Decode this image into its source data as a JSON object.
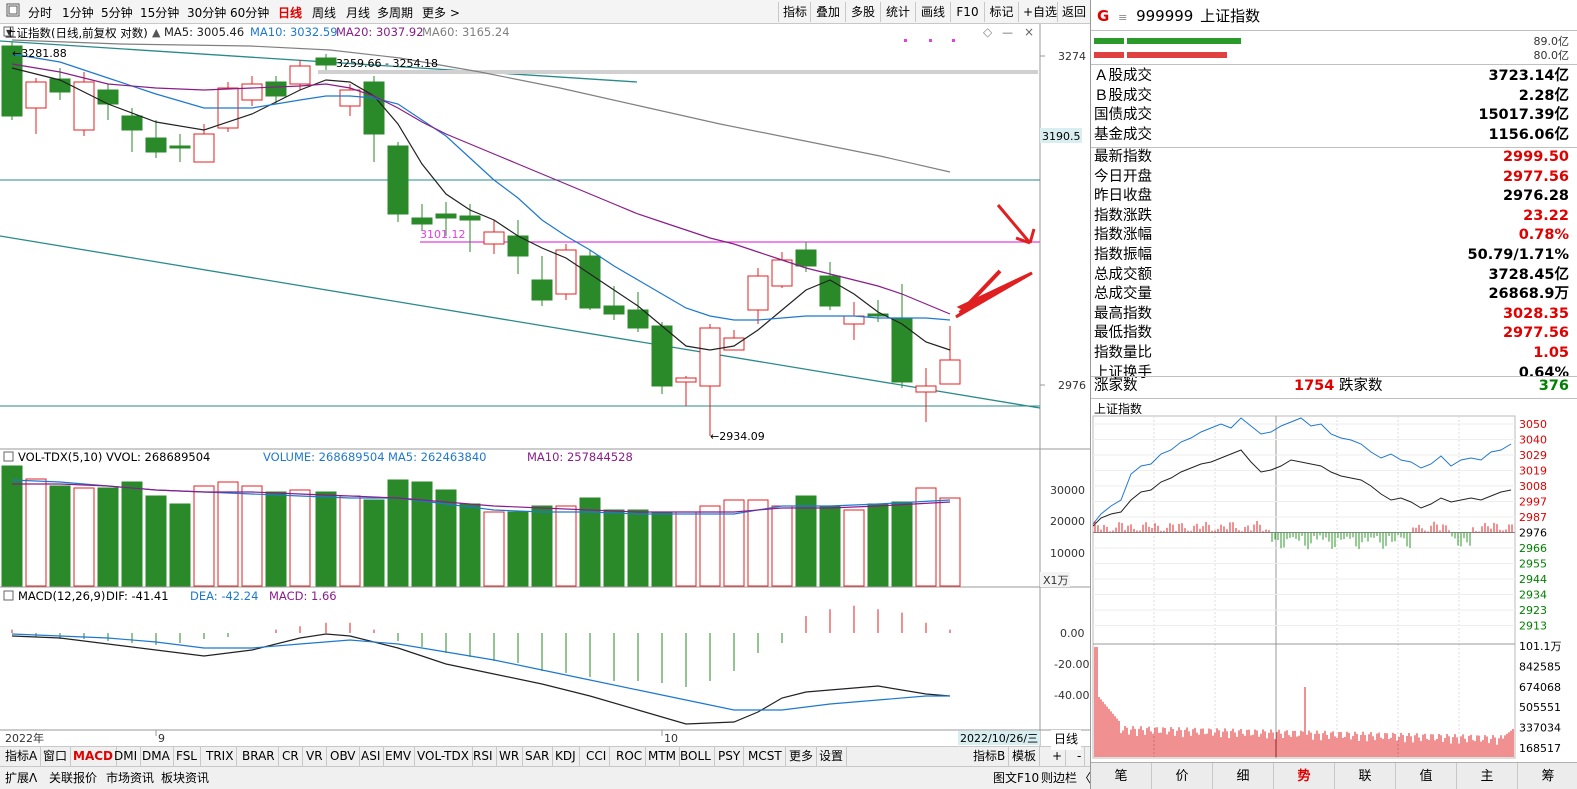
{
  "toolbar": {
    "periods": [
      "分时",
      "1分钟",
      "5分钟",
      "15分钟",
      "30分钟",
      "60分钟",
      "日线",
      "周线",
      "月线",
      "多周期",
      "更多"
    ],
    "active_period": "日线",
    "right_buttons": [
      "指标",
      "叠加",
      "多股",
      "统计",
      "画线",
      "F10",
      "标记",
      "+自选",
      "返回"
    ]
  },
  "main_chart": {
    "title": "上证指数(日线,前复权 对数)",
    "ma_labels": [
      {
        "text": "MA5: 3005.46",
        "color": "#222222"
      },
      {
        "text": "MA10: 3032.59",
        "color": "#1e78d0"
      },
      {
        "text": "MA20: 3037.92",
        "color": "#8a1c8a"
      },
      {
        "text": "MA60: 3165.24",
        "color": "#808080"
      }
    ],
    "price_axis": [
      "3274",
      "3190.5",
      "2976"
    ],
    "highlight_price": "3190.5",
    "annotations": {
      "high": "3281.88",
      "range": "3259.66 - 3254.18",
      "level": "3101.12",
      "low": "2934.09"
    },
    "date_labels": [
      "2022年",
      "9",
      "10"
    ],
    "current_date": "2022/10/26/三"
  },
  "volume_chart": {
    "labels": [
      {
        "text": "VOL-TDX(5,10)",
        "color": "#000000"
      },
      {
        "text": "VVOL: 268689504",
        "color": "#000000"
      },
      {
        "text": "VOLUME: 268689504",
        "color": "#1e78d0"
      },
      {
        "text": "MA5: 262463840",
        "color": "#1e78d0"
      },
      {
        "text": "MA10: 257844528",
        "color": "#8a1c8a"
      }
    ],
    "axis": [
      "30000",
      "20000",
      "10000"
    ],
    "unit": "X1万"
  },
  "macd_chart": {
    "labels": [
      {
        "text": "MACD(12,26,9)",
        "color": "#000000"
      },
      {
        "text": "DIF: -41.41",
        "color": "#000000"
      },
      {
        "text": "DEA: -42.24",
        "color": "#1e78d0"
      },
      {
        "text": "MACD: 1.66",
        "color": "#8a1c8a"
      }
    ],
    "axis": [
      "0.00",
      "-20.00",
      "-40.00"
    ]
  },
  "indicator_tabs": [
    "指标A",
    "窗口",
    "MACD",
    "DMI",
    "DMA",
    "FSL",
    "TRIX",
    "BRAR",
    "CR",
    "VR",
    "OBV",
    "ASI",
    "EMV",
    "VOL-TDX",
    "RSI",
    "WR",
    "SAR",
    "KDJ",
    "CCI",
    "ROC",
    "MTM",
    "BOLL",
    "PSY",
    "MCST",
    "更多",
    "设置"
  ],
  "active_indicator": "MACD",
  "indicator_right": [
    "指标B",
    "模板",
    "+",
    "-"
  ],
  "period_right": "日线",
  "bottom_bar": [
    "扩展Ʌ",
    "关联报价",
    "市场资讯",
    "板块资讯"
  ],
  "bottom_right": [
    "图文F10",
    "则边栏"
  ],
  "panel": {
    "code": "999999",
    "name": "上证指数",
    "bar1_pct": "89.0亿",
    "bar2_pct": "80.0亿",
    "rows1": [
      {
        "label": "Ａ股成交",
        "value": "3723.14亿",
        "color": "black"
      },
      {
        "label": "Ｂ股成交",
        "value": "2.28亿",
        "color": "black"
      },
      {
        "label": "国债成交",
        "value": "15017.39亿",
        "color": "black"
      },
      {
        "label": "基金成交",
        "value": "1156.06亿",
        "color": "black"
      }
    ],
    "rows2": [
      {
        "label": "最新指数",
        "value": "2999.50",
        "color": "red"
      },
      {
        "label": "今日开盘",
        "value": "2977.56",
        "color": "red"
      },
      {
        "label": "昨日收盘",
        "value": "2976.28",
        "color": "black"
      },
      {
        "label": "指数涨跌",
        "value": "23.22",
        "color": "red"
      },
      {
        "label": "指数涨幅",
        "value": "0.78%",
        "color": "red"
      },
      {
        "label": "指数振幅",
        "value": "50.79/1.71%",
        "color": "black"
      },
      {
        "label": "总成交额",
        "value": "3728.45亿",
        "color": "black"
      },
      {
        "label": "总成交量",
        "value": "26868.9万",
        "color": "black"
      },
      {
        "label": "最高指数",
        "value": "3028.35",
        "color": "red"
      },
      {
        "label": "最低指数",
        "value": "2977.56",
        "color": "red"
      },
      {
        "label": "指数量比",
        "value": "1.05",
        "color": "red"
      },
      {
        "label": "上证换手",
        "value": "0.64%",
        "color": "black"
      }
    ],
    "up_label": "涨家数",
    "up_value": "1754",
    "down_label": "跌家数",
    "down_value": "376",
    "intraday_title": "上证指数",
    "intraday_axis": [
      "3050",
      "3040",
      "3029",
      "3019",
      "3008",
      "2997",
      "2987",
      "2976",
      "2966",
      "2955",
      "2944",
      "2934",
      "2923",
      "2913"
    ],
    "intraday_vol_axis": [
      "101.1万",
      "842585",
      "674068",
      "505551",
      "337034",
      "168517"
    ],
    "tabs": [
      "笔",
      "价",
      "细",
      "势",
      "联",
      "值",
      "主",
      "筹"
    ],
    "active_tab": "势"
  }
}
